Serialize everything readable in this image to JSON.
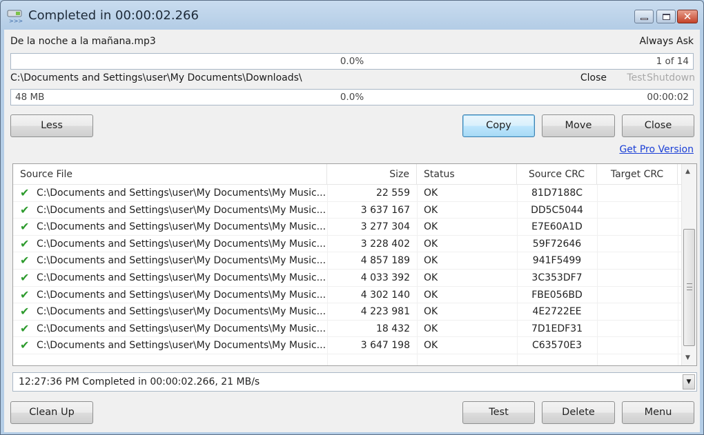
{
  "window": {
    "title": "Completed in 00:00:02.266",
    "icons": {
      "app": "copy-app-icon",
      "minimize": "minimize-icon",
      "maximize": "maximize-icon",
      "close": "close-icon"
    }
  },
  "current_file": {
    "name": "De la noche a la mañana.mp3",
    "overwrite_mode": "Always Ask",
    "progress_percent_label": "0.0%",
    "progress_fraction": 0.0,
    "count_label": "1 of 14"
  },
  "destination": {
    "path": "C:\\Documents and Settings\\user\\My Documents\\Downloads\\",
    "after_actions": {
      "close": "Close",
      "test": "Test",
      "shutdown": "Shutdown"
    },
    "size_label": "48 MB",
    "progress_percent_label": "0.0%",
    "progress_fraction": 0.0,
    "elapsed": "00:00:02"
  },
  "buttons": {
    "less": "Less",
    "copy": "Copy",
    "move": "Move",
    "close": "Close",
    "clean_up": "Clean Up",
    "test": "Test",
    "delete": "Delete",
    "menu": "Menu"
  },
  "links": {
    "pro": "Get Pro Version"
  },
  "table": {
    "columns": [
      "Source File",
      "Size",
      "Status",
      "Source CRC",
      "Target CRC"
    ],
    "rows": [
      {
        "file": "C:\\Documents and Settings\\user\\My Documents\\My Music...",
        "size": "22 559",
        "status": "OK",
        "source_crc": "81D7188C",
        "target_crc": ""
      },
      {
        "file": "C:\\Documents and Settings\\user\\My Documents\\My Music...",
        "size": "3 637 167",
        "status": "OK",
        "source_crc": "DD5C5044",
        "target_crc": ""
      },
      {
        "file": "C:\\Documents and Settings\\user\\My Documents\\My Music...",
        "size": "3 277 304",
        "status": "OK",
        "source_crc": "E7E60A1D",
        "target_crc": ""
      },
      {
        "file": "C:\\Documents and Settings\\user\\My Documents\\My Music...",
        "size": "3 228 402",
        "status": "OK",
        "source_crc": "59F72646",
        "target_crc": ""
      },
      {
        "file": "C:\\Documents and Settings\\user\\My Documents\\My Music...",
        "size": "4 857 189",
        "status": "OK",
        "source_crc": "941F5499",
        "target_crc": ""
      },
      {
        "file": "C:\\Documents and Settings\\user\\My Documents\\My Music...",
        "size": "4 033 392",
        "status": "OK",
        "source_crc": "3C353DF7",
        "target_crc": ""
      },
      {
        "file": "C:\\Documents and Settings\\user\\My Documents\\My Music...",
        "size": "4 302 140",
        "status": "OK",
        "source_crc": "FBE056BD",
        "target_crc": ""
      },
      {
        "file": "C:\\Documents and Settings\\user\\My Documents\\My Music...",
        "size": "4 223 981",
        "status": "OK",
        "source_crc": "4E2722EE",
        "target_crc": ""
      },
      {
        "file": "C:\\Documents and Settings\\user\\My Documents\\My Music...",
        "size": "18 432",
        "status": "OK",
        "source_crc": "7D1EDF31",
        "target_crc": ""
      },
      {
        "file": "C:\\Documents and Settings\\user\\My Documents\\My Music...",
        "size": "3 647 198",
        "status": "OK",
        "source_crc": "C63570E3",
        "target_crc": ""
      }
    ],
    "row_icon": "checkmark-icon"
  },
  "log": {
    "selected": "12:27:36 PM Completed in 00:00:02.266, 21 MB/s"
  },
  "colors": {
    "link": "#1a3fd6",
    "check": "#2e9b2e",
    "disabled_text": "#a8a8a8",
    "default_button_border": "#3c7fb1"
  }
}
